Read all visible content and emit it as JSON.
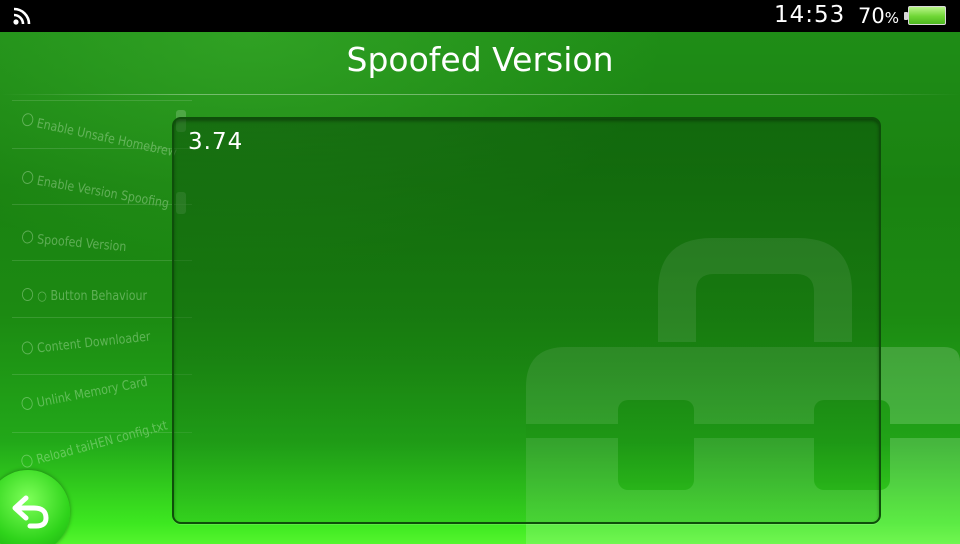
{
  "status_bar": {
    "time": "14:53",
    "battery_percent": "70",
    "battery_percent_sign": "%",
    "battery_level": 0.7,
    "wifi_icon": "wifi-icon"
  },
  "header": {
    "title": "Spoofed Version"
  },
  "editor": {
    "value": "3.74"
  },
  "background_menu": {
    "items": [
      "Enable Unsafe Homebrew",
      "Enable Version Spoofing",
      "Spoofed Version",
      "○ Button Behaviour",
      "Content Downloader",
      "Unlink Memory Card",
      "Reload taiHEN config.txt"
    ]
  },
  "back_button": {
    "icon": "back-arrow-icon"
  },
  "colors": {
    "status_bar_bg": "#000000",
    "screen_green": "#1a8211",
    "screen_bright_green": "#54f52e",
    "battery_green": "#6fd635"
  }
}
